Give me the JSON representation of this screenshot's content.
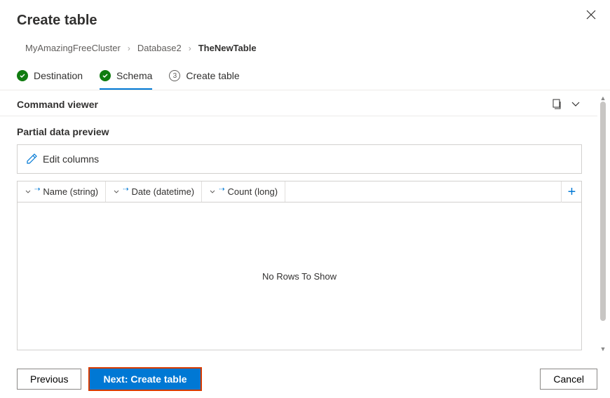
{
  "header": {
    "title": "Create table"
  },
  "breadcrumb": {
    "items": [
      "MyAmazingFreeCluster",
      "Database2",
      "TheNewTable"
    ]
  },
  "steps": [
    {
      "label": "Destination",
      "state": "done"
    },
    {
      "label": "Schema",
      "state": "done",
      "active": true
    },
    {
      "label": "Create table",
      "state": "pending",
      "number": "3"
    }
  ],
  "commandViewer": {
    "title": "Command viewer"
  },
  "preview": {
    "title": "Partial data preview",
    "editColumns": "Edit columns",
    "columns": [
      {
        "name": "Name (string)"
      },
      {
        "name": "Date (datetime)"
      },
      {
        "name": "Count (long)"
      }
    ],
    "emptyMessage": "No Rows To Show"
  },
  "footer": {
    "previous": "Previous",
    "next": "Next: Create table",
    "cancel": "Cancel"
  }
}
